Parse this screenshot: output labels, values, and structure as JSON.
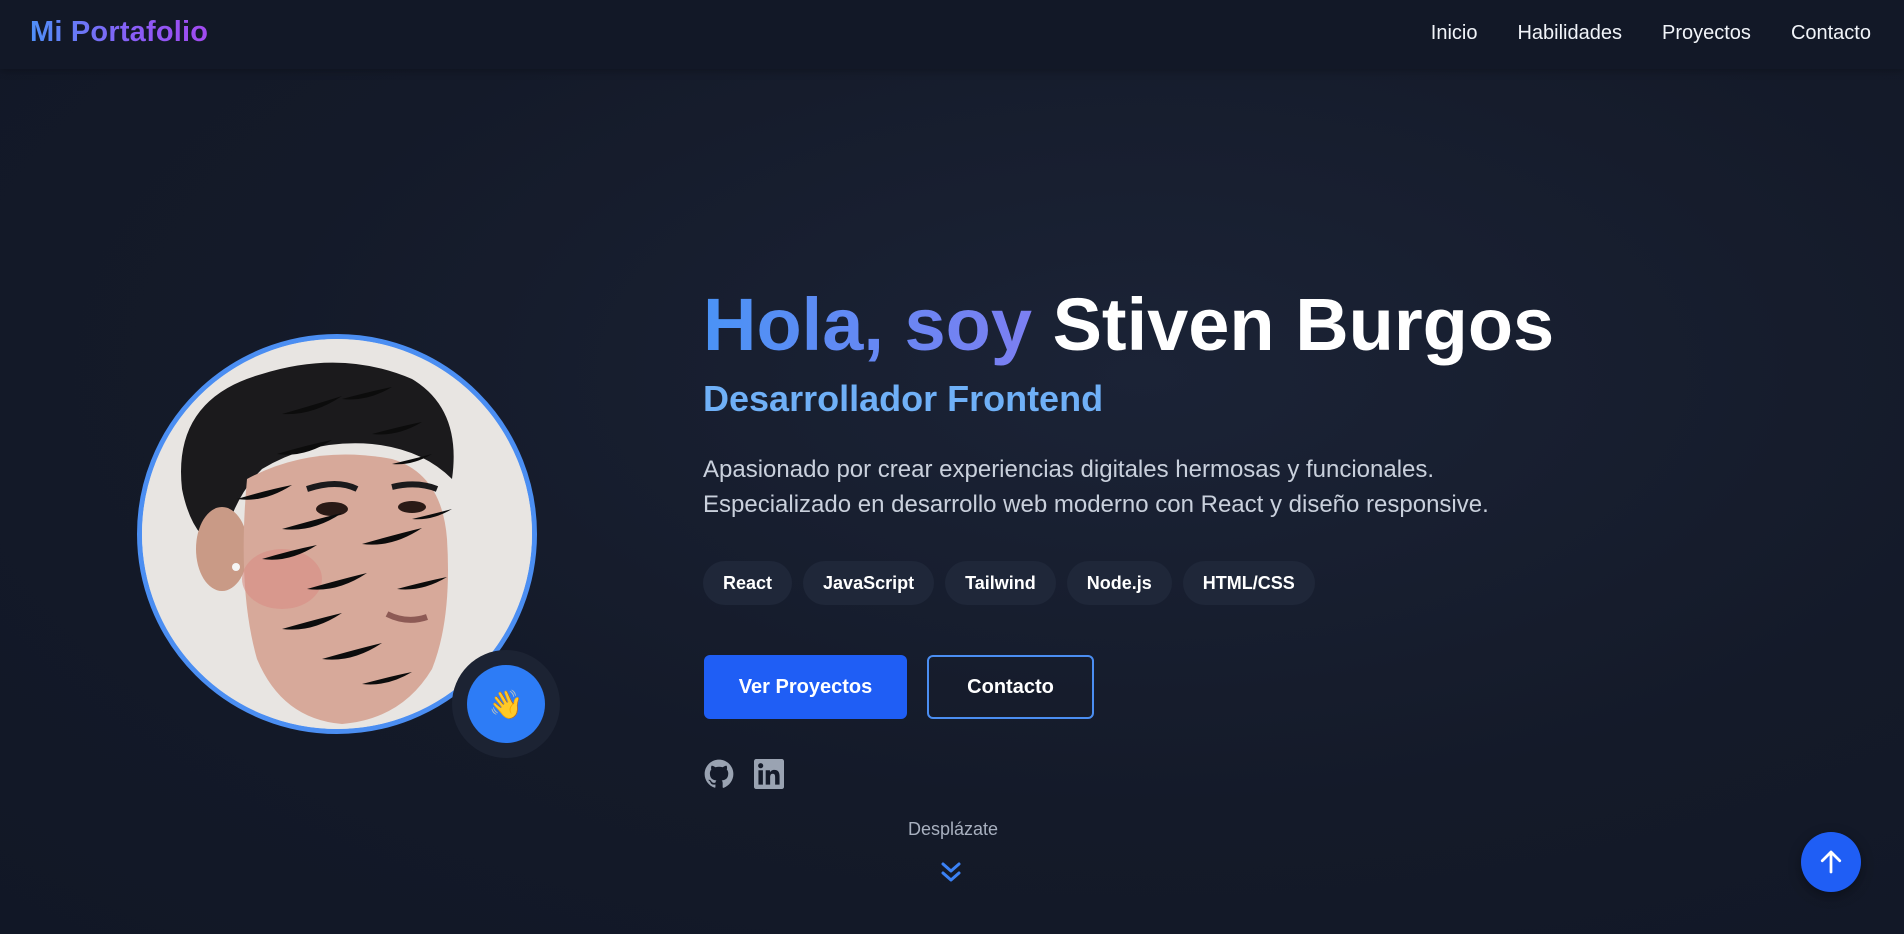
{
  "brand": {
    "logo_text": "Mi Portafolio"
  },
  "nav": {
    "items": [
      {
        "label": "Inicio"
      },
      {
        "label": "Habilidades"
      },
      {
        "label": "Proyectos"
      },
      {
        "label": "Contacto"
      }
    ]
  },
  "hero": {
    "greeting": "Hola, soy",
    "name": "Stiven Burgos",
    "role": "Desarrollador Frontend",
    "description_line1": "Apasionado por crear experiencias digitales hermosas y funcionales.",
    "description_line2": "Especializado en desarrollo web moderno con React y diseño responsive.",
    "tags": [
      "React",
      "JavaScript",
      "Tailwind",
      "Node.js",
      "HTML/CSS"
    ],
    "primary_button": "Ver Proyectos",
    "secondary_button": "Contacto",
    "wave_emoji": "👋",
    "social": [
      {
        "icon": "github-icon"
      },
      {
        "icon": "linkedin-icon"
      }
    ],
    "scroll_hint": "Desplázate"
  },
  "colors": {
    "accent": "#1f5ef5",
    "accent_light": "#4b8ef2",
    "role": "#6fb0f7",
    "background": "#141a29"
  }
}
